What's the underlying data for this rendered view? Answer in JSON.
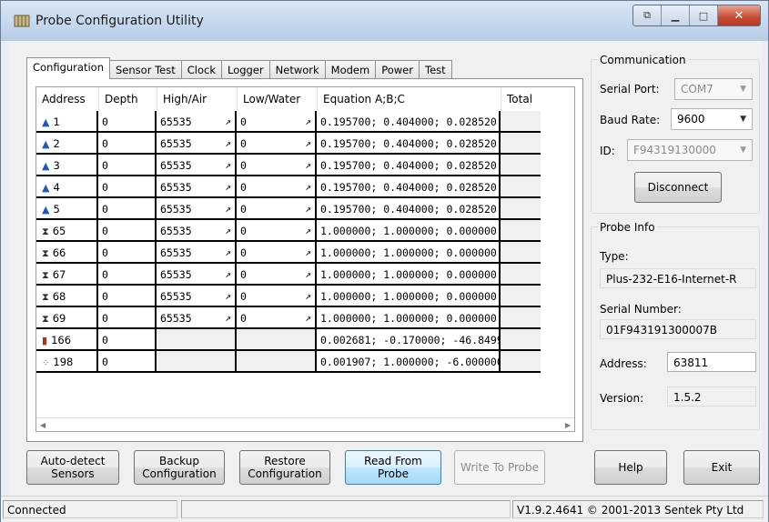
{
  "window": {
    "title": "Probe Configuration Utility"
  },
  "tabs": [
    "Configuration",
    "Sensor Test",
    "Clock",
    "Logger",
    "Network",
    "Modem",
    "Power",
    "Test"
  ],
  "grid": {
    "headers": [
      "Address",
      "Depth",
      "High/Air",
      "Low/Water",
      "Equation  A;B;C",
      "Total"
    ],
    "rows": [
      {
        "icon": "drop",
        "address": "1",
        "depth": "0",
        "high": "65535",
        "low": "0",
        "equation": "0.195700; 0.404000; 0.028520",
        "total": ""
      },
      {
        "icon": "drop",
        "address": "2",
        "depth": "0",
        "high": "65535",
        "low": "0",
        "equation": "0.195700; 0.404000; 0.028520",
        "total": ""
      },
      {
        "icon": "drop",
        "address": "3",
        "depth": "0",
        "high": "65535",
        "low": "0",
        "equation": "0.195700; 0.404000; 0.028520",
        "total": ""
      },
      {
        "icon": "drop",
        "address": "4",
        "depth": "0",
        "high": "65535",
        "low": "0",
        "equation": "0.195700; 0.404000; 0.028520",
        "total": ""
      },
      {
        "icon": "drop",
        "address": "5",
        "depth": "0",
        "high": "65535",
        "low": "0",
        "equation": "0.195700; 0.404000; 0.028520",
        "total": ""
      },
      {
        "icon": "hourglass",
        "address": "65",
        "depth": "0",
        "high": "65535",
        "low": "0",
        "equation": "1.000000; 1.000000; 0.000000",
        "total": ""
      },
      {
        "icon": "hourglass",
        "address": "66",
        "depth": "0",
        "high": "65535",
        "low": "0",
        "equation": "1.000000; 1.000000; 0.000000",
        "total": ""
      },
      {
        "icon": "hourglass",
        "address": "67",
        "depth": "0",
        "high": "65535",
        "low": "0",
        "equation": "1.000000; 1.000000; 0.000000",
        "total": ""
      },
      {
        "icon": "hourglass",
        "address": "68",
        "depth": "0",
        "high": "65535",
        "low": "0",
        "equation": "1.000000; 1.000000; 0.000000",
        "total": ""
      },
      {
        "icon": "hourglass",
        "address": "69",
        "depth": "0",
        "high": "65535",
        "low": "0",
        "equation": "1.000000; 1.000000; 0.000000",
        "total": ""
      },
      {
        "icon": "thermometer",
        "address": "166",
        "depth": "0",
        "high": "",
        "low": "",
        "equation": "0.002681; -0.170000; -46.8499",
        "total": ""
      },
      {
        "icon": "dots",
        "address": "198",
        "depth": "0",
        "high": "",
        "low": "",
        "equation": "0.001907; 1.000000; -6.000000",
        "total": ""
      }
    ]
  },
  "communication": {
    "group_label": "Communication",
    "serial_port_label": "Serial Port:",
    "serial_port_value": "COM7",
    "baud_rate_label": "Baud Rate:",
    "baud_rate_value": "9600",
    "id_label": "ID:",
    "id_value": "F94319130000",
    "disconnect_label": "Disconnect"
  },
  "probe_info": {
    "group_label": "Probe Info",
    "type_label": "Type:",
    "type_value": "Plus-232-E16-Internet-R",
    "serial_label": "Serial Number:",
    "serial_value": "01F943191300007B",
    "address_label": "Address:",
    "address_value": "63811",
    "version_label": "Version:",
    "version_value": "1.5.2"
  },
  "buttons": {
    "auto_detect": "Auto-detect\nSensors",
    "backup": "Backup\nConfiguration",
    "restore": "Restore\nConfiguration",
    "read": "Read From\nProbe",
    "write": "Write To Probe",
    "help": "Help",
    "exit": "Exit"
  },
  "status": {
    "left": "Connected",
    "right": "V1.9.2.4641 © 2001-2013 Sentek Pty Ltd"
  },
  "icons": {
    "drop": "water-drop-icon",
    "hourglass": "hourglass-icon",
    "thermometer": "thermometer-icon",
    "dots": "salinity-dots-icon",
    "spark": "calibrate-icon"
  }
}
